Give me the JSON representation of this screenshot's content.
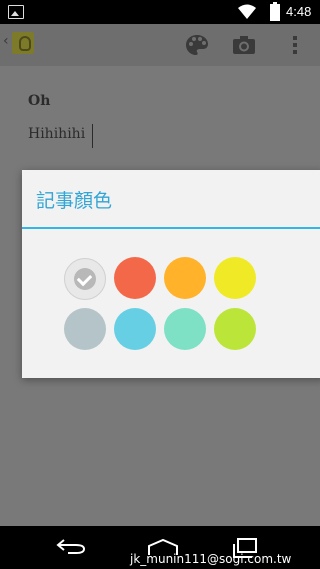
{
  "status_bar": {
    "time": "4:48"
  },
  "app_bar": {
    "icons": [
      "back-chevron",
      "keep-logo",
      "palette-icon",
      "camera-icon",
      "overflow-icon"
    ]
  },
  "note": {
    "title": "Oh",
    "body": "Hihihihi"
  },
  "dialog": {
    "title": "記事顏色",
    "swatches": [
      {
        "name": "white",
        "color": "#e8e8e8",
        "selected": true
      },
      {
        "name": "red",
        "color": "#f4684a",
        "selected": false
      },
      {
        "name": "orange",
        "color": "#ffb22a",
        "selected": false
      },
      {
        "name": "yellow",
        "color": "#efea25",
        "selected": false
      },
      {
        "name": "gray",
        "color": "#b5c4c8",
        "selected": false
      },
      {
        "name": "blue",
        "color": "#66cfe4",
        "selected": false
      },
      {
        "name": "teal",
        "color": "#7ee0c4",
        "selected": false
      },
      {
        "name": "green",
        "color": "#bce53a",
        "selected": false
      }
    ],
    "accent": "#33b5e5"
  },
  "watermark": "jk_munin111@sogi.com.tw"
}
